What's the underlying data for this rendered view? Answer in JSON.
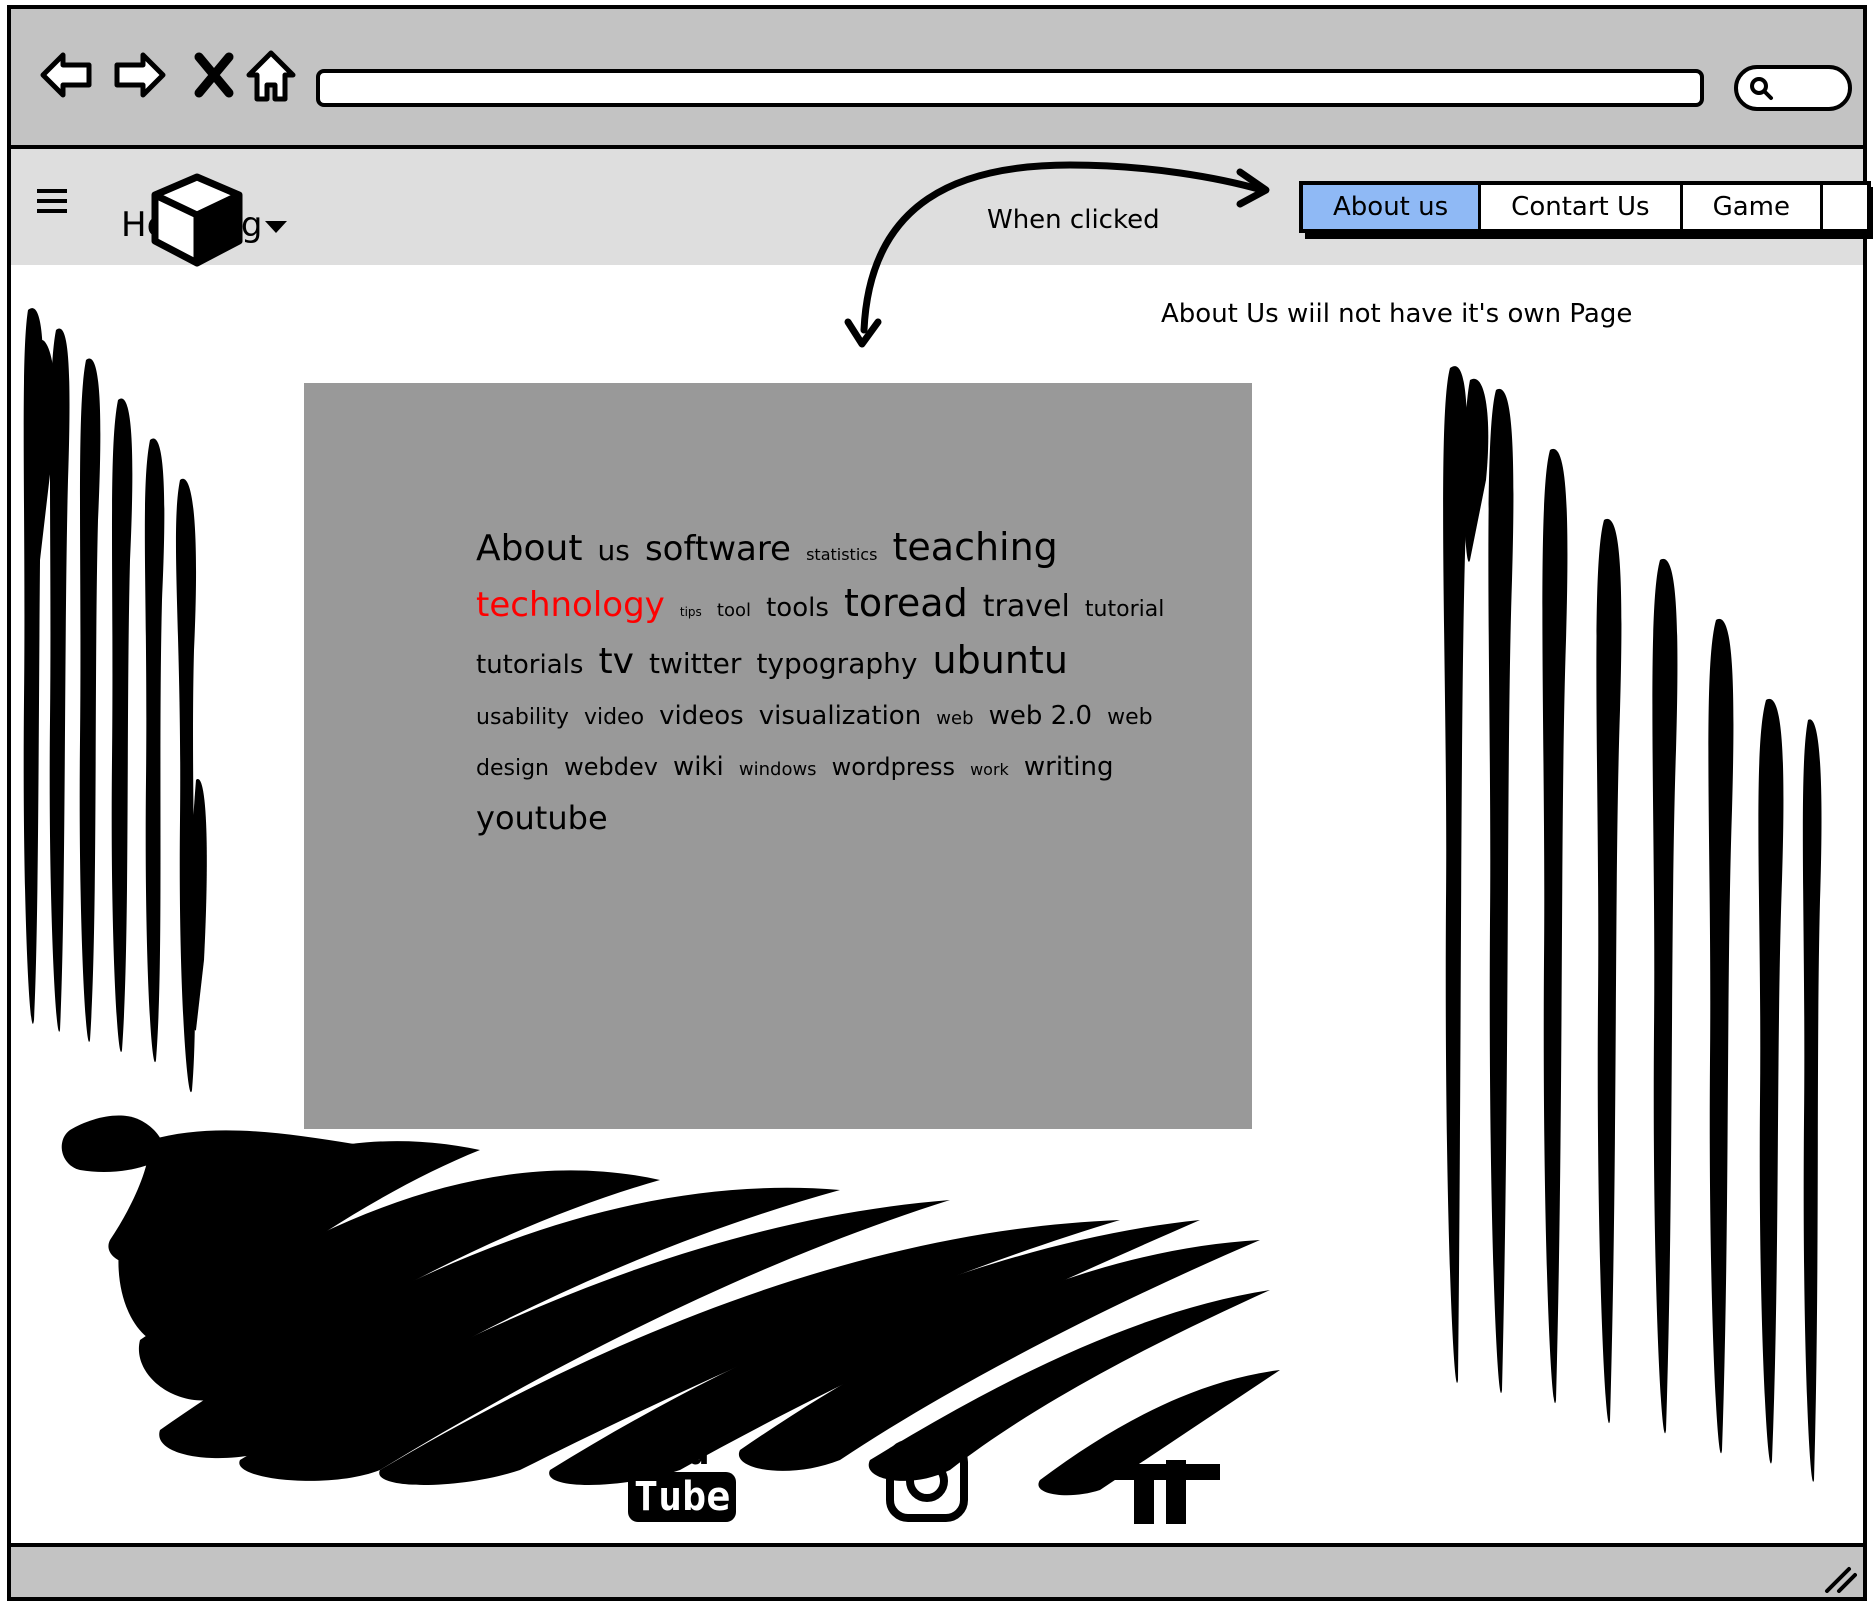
{
  "browser": {
    "back_icon": "back-arrow-icon",
    "forward_icon": "forward-arrow-icon",
    "stop_icon": "close-icon",
    "home_icon": "home-icon",
    "address_value": "",
    "search_icon": "search-icon"
  },
  "header": {
    "menu_icon": "hamburger-icon",
    "title": "Heading",
    "logo_icon": "cube-icon",
    "dropdown_icon": "chevron-down-icon",
    "tabs": [
      {
        "label": "About us",
        "active": true
      },
      {
        "label": "Contart Us",
        "active": false
      },
      {
        "label": "Game",
        "active": false
      },
      {
        "label": "",
        "active": false
      }
    ]
  },
  "annotations": {
    "when_clicked": "When clicked",
    "about_note": "About Us wiil not have it's own Page"
  },
  "tag_cloud": {
    "tags": [
      {
        "text": "About",
        "size": 36,
        "color": "#000000"
      },
      {
        "text": "us",
        "size": 28,
        "color": "#000000"
      },
      {
        "text": "software",
        "size": 34,
        "color": "#000000"
      },
      {
        "text": "statistics",
        "size": 16,
        "color": "#000000"
      },
      {
        "text": "teaching",
        "size": 38,
        "color": "#000000"
      },
      {
        "text": "technology",
        "size": 34,
        "color": "#ff0000"
      },
      {
        "text": "tips",
        "size": 12,
        "color": "#000000"
      },
      {
        "text": "tool",
        "size": 18,
        "color": "#000000"
      },
      {
        "text": "tools",
        "size": 26,
        "color": "#000000"
      },
      {
        "text": "toread",
        "size": 38,
        "color": "#000000"
      },
      {
        "text": "travel",
        "size": 30,
        "color": "#000000"
      },
      {
        "text": "tutorial",
        "size": 22,
        "color": "#000000"
      },
      {
        "text": "tutorials",
        "size": 26,
        "color": "#000000"
      },
      {
        "text": "tv",
        "size": 36,
        "color": "#000000"
      },
      {
        "text": "twitter",
        "size": 28,
        "color": "#000000"
      },
      {
        "text": "typography",
        "size": 28,
        "color": "#000000"
      },
      {
        "text": "ubuntu",
        "size": 38,
        "color": "#000000"
      },
      {
        "text": "usability",
        "size": 22,
        "color": "#000000"
      },
      {
        "text": "video",
        "size": 22,
        "color": "#000000"
      },
      {
        "text": "videos",
        "size": 26,
        "color": "#000000"
      },
      {
        "text": "visualization",
        "size": 26,
        "color": "#000000"
      },
      {
        "text": "web",
        "size": 18,
        "color": "#000000"
      },
      {
        "text": "web 2.0",
        "size": 26,
        "color": "#000000"
      },
      {
        "text": "web design",
        "size": 22,
        "color": "#000000"
      },
      {
        "text": "webdev",
        "size": 24,
        "color": "#000000"
      },
      {
        "text": "wiki",
        "size": 26,
        "color": "#000000"
      },
      {
        "text": "windows",
        "size": 18,
        "color": "#000000"
      },
      {
        "text": "wordpress",
        "size": 24,
        "color": "#000000"
      },
      {
        "text": "work",
        "size": 16,
        "color": "#000000"
      },
      {
        "text": "writing",
        "size": 26,
        "color": "#000000"
      },
      {
        "text": "youtube",
        "size": 32,
        "color": "#000000"
      }
    ]
  },
  "social": {
    "youtube_top": "You",
    "youtube_bottom": "Tube",
    "youtube_icon": "youtube-icon",
    "instagram_icon": "instagram-icon",
    "facebook_icon": "facebook-icon"
  },
  "colors": {
    "chrome": "#c3c3c3",
    "header_bg": "#dedede",
    "tab_active": "#8fb9f5",
    "content_box": "#999999",
    "highlight": "#ff0000"
  }
}
